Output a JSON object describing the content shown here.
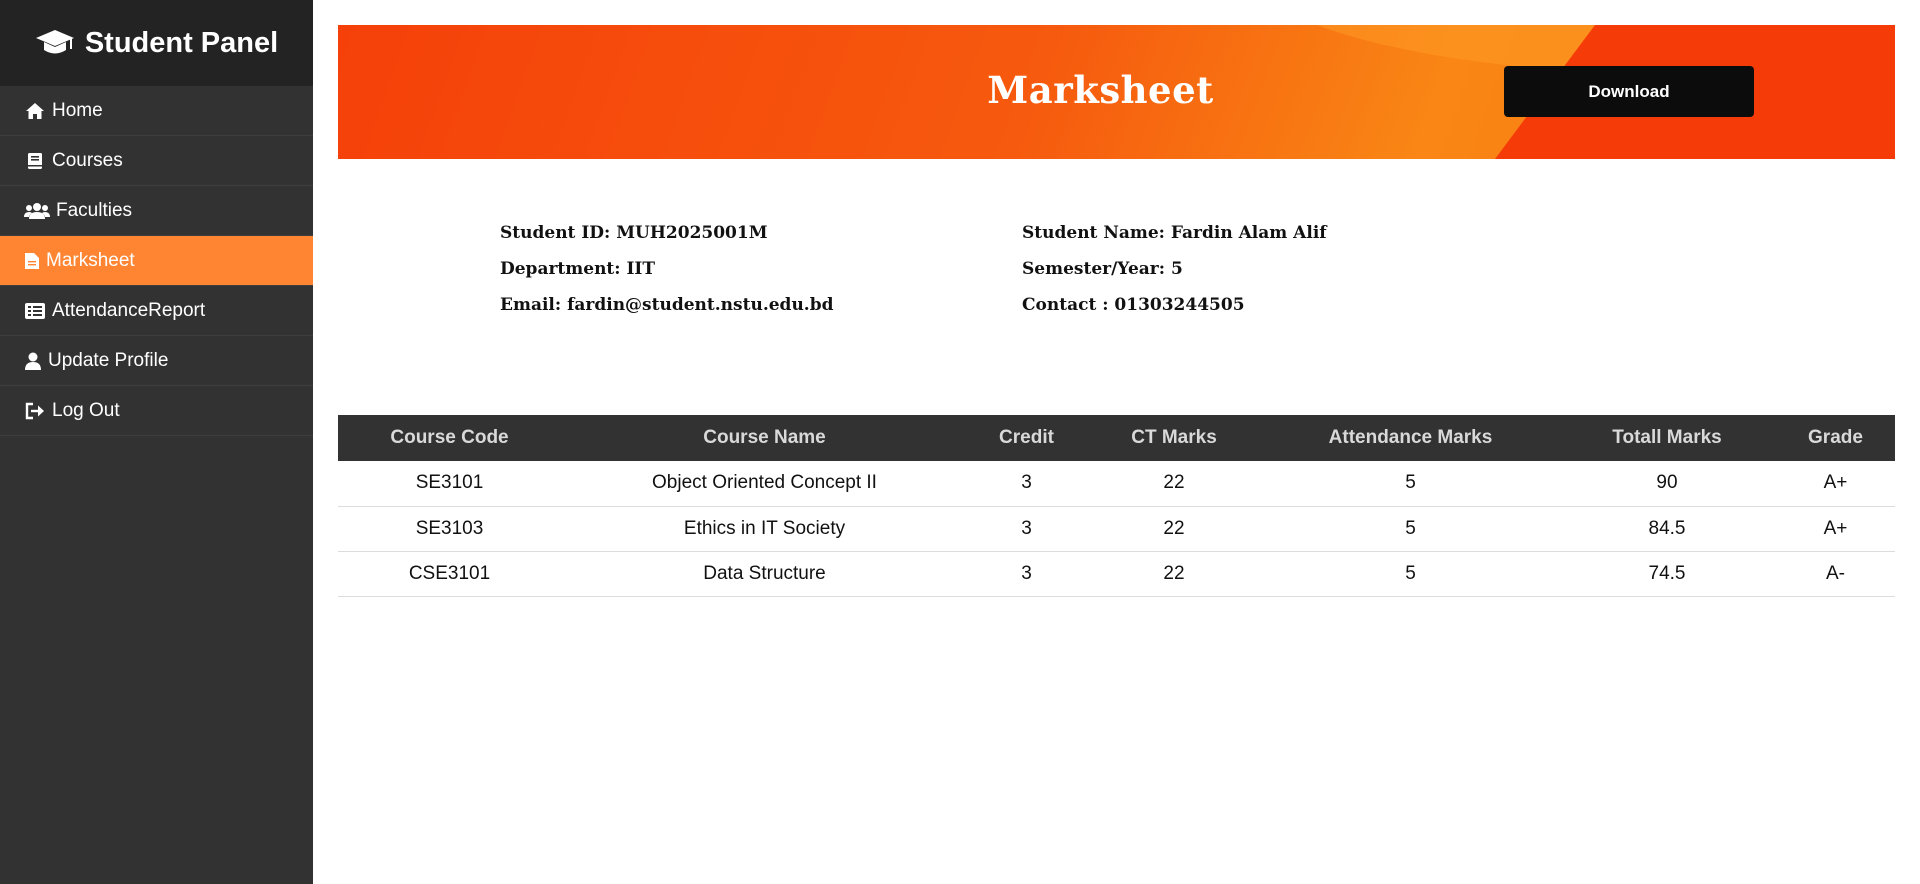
{
  "sidebar": {
    "brand_title": "Student Panel",
    "brand_icon": "graduation-cap-icon",
    "items": [
      {
        "label": "Home",
        "icon": "home-icon",
        "active": false
      },
      {
        "label": "Courses",
        "icon": "book-icon",
        "active": false
      },
      {
        "label": "Faculties",
        "icon": "users-icon",
        "active": false
      },
      {
        "label": "Marksheet",
        "icon": "file-icon",
        "active": true
      },
      {
        "label": "AttendanceReport",
        "icon": "list-icon",
        "active": false
      },
      {
        "label": "Update Profile",
        "icon": "user-icon",
        "active": false
      },
      {
        "label": "Log Out",
        "icon": "logout-icon",
        "active": false
      }
    ]
  },
  "colors": {
    "sidebar_bg": "#323232",
    "brand_bg": "#232323",
    "active_item": "#ff8533",
    "banner_primary": "#f5400a",
    "banner_secondary": "#f98615",
    "button_bg": "#0c0c0c",
    "table_header_bg": "#323232"
  },
  "banner": {
    "title": "Marksheet",
    "download_label": "Download"
  },
  "student": {
    "id": "Student ID: MUH2025001M",
    "department": "Department: IIT",
    "email": "Email: fardin@student.nstu.edu.bd",
    "name": "Student Name: Fardin Alam Alif",
    "semester": "Semester/Year: 5",
    "contact": "Contact : 01303244505"
  },
  "table": {
    "headers": [
      "Course Code",
      "Course Name",
      "Credit",
      "CT Marks",
      "Attendance Marks",
      "Totall Marks",
      "Grade"
    ],
    "rows": [
      [
        "SE3101",
        "Object Oriented Concept II",
        "3",
        "22",
        "5",
        "90",
        "A+"
      ],
      [
        "SE3103",
        "Ethics in IT Society",
        "3",
        "22",
        "5",
        "84.5",
        "A+"
      ],
      [
        "CSE3101",
        "Data Structure",
        "3",
        "22",
        "5",
        "74.5",
        "A-"
      ]
    ]
  }
}
